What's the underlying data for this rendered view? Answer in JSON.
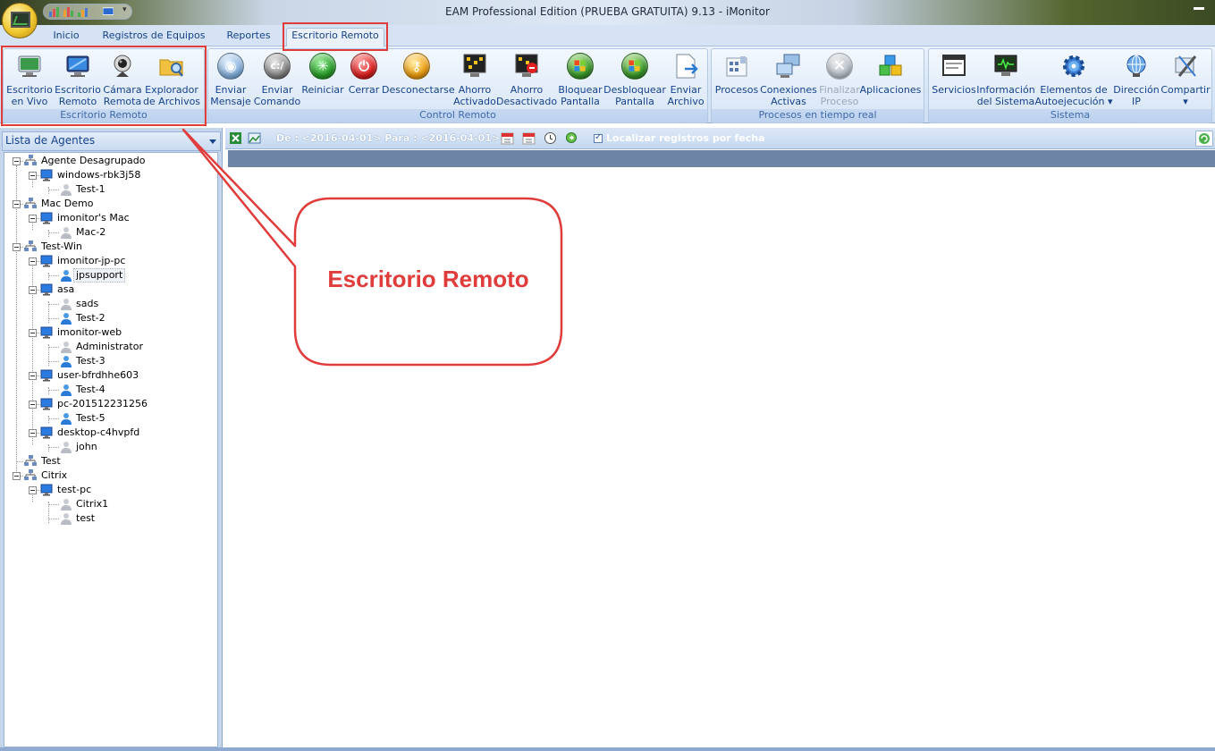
{
  "window": {
    "title": "EAM Professional Edition (PRUEBA GRATUITA) 9.13 - iMonitor"
  },
  "tabs": [
    {
      "label": "Inicio",
      "active": false
    },
    {
      "label": "Registros de Equipos",
      "active": false
    },
    {
      "label": "Reportes",
      "active": false
    },
    {
      "label": "Escritorio Remoto",
      "active": true
    }
  ],
  "ribbon": {
    "groups": [
      {
        "label": "Escritorio Remoto",
        "buttons": [
          {
            "label": "Escritorio\nen Vivo",
            "icon": "monitor-live-icon"
          },
          {
            "label": "Escritorio\nRemoto",
            "icon": "remote-desktop-icon"
          },
          {
            "label": "Cámara\nRemota",
            "icon": "webcam-icon"
          },
          {
            "label": "Explorador\nde Archivos",
            "icon": "folder-search-icon"
          }
        ]
      },
      {
        "label": "Control Remoto",
        "buttons": [
          {
            "label": "Enviar\nMensaje",
            "icon": "message-icon"
          },
          {
            "label": "Enviar\nComando",
            "icon": "command-icon"
          },
          {
            "label": "Reiniciar",
            "icon": "restart-icon"
          },
          {
            "label": "Cerrar",
            "icon": "power-icon"
          },
          {
            "label": "Desconectarse",
            "icon": "logoff-key-icon"
          },
          {
            "label": "Ahorro\nActivado",
            "icon": "power-save-on-icon"
          },
          {
            "label": "Ahorro\nDesactivado",
            "icon": "power-save-off-icon"
          },
          {
            "label": "Bloquear\nPantalla",
            "icon": "lock-screen-icon"
          },
          {
            "label": "Desbloquear\nPantalla",
            "icon": "unlock-screen-icon"
          },
          {
            "label": "Enviar\nArchivo",
            "icon": "send-file-icon"
          }
        ]
      },
      {
        "label": "Procesos en tiempo real",
        "buttons": [
          {
            "label": "Procesos",
            "icon": "processes-icon"
          },
          {
            "label": "Conexiones\nActivas",
            "icon": "network-connections-icon"
          },
          {
            "label": "Finalizar\nProceso",
            "icon": "end-process-icon",
            "disabled": true
          },
          {
            "label": "Aplicaciones",
            "icon": "applications-icon"
          }
        ]
      },
      {
        "label": "Sistema",
        "buttons": [
          {
            "label": "Servicios",
            "icon": "services-icon"
          },
          {
            "label": "Información\ndel Sistema",
            "icon": "system-info-icon"
          },
          {
            "label": "Elementos de\nAutoejecución ▾",
            "icon": "startup-gear-icon"
          },
          {
            "label": "Dirección\nIP",
            "icon": "ip-address-icon"
          },
          {
            "label": "Compartir\n▾",
            "icon": "share-icon"
          }
        ]
      }
    ]
  },
  "agents_panel": {
    "title": "Lista de Agentes",
    "tree": [
      {
        "label": "Agente Desagrupado",
        "type": "group"
      },
      {
        "label": "windows-rbk3j58",
        "type": "computer"
      },
      {
        "label": "Test-1",
        "type": "user-offline"
      },
      {
        "label": "Mac Demo",
        "type": "group"
      },
      {
        "label": "imonitor's Mac",
        "type": "computer"
      },
      {
        "label": "Mac-2",
        "type": "user-offline"
      },
      {
        "label": "Test-Win",
        "type": "group"
      },
      {
        "label": "imonitor-jp-pc",
        "type": "computer"
      },
      {
        "label": "jpsupport",
        "type": "user-online",
        "selected": true
      },
      {
        "label": "asa",
        "type": "computer"
      },
      {
        "label": "sads",
        "type": "user-offline"
      },
      {
        "label": "Test-2",
        "type": "user-online"
      },
      {
        "label": "imonitor-web",
        "type": "computer"
      },
      {
        "label": "Administrator",
        "type": "user-offline"
      },
      {
        "label": "Test-3",
        "type": "user-online"
      },
      {
        "label": "user-bfrdhhe603",
        "type": "computer"
      },
      {
        "label": "Test-4",
        "type": "user-online"
      },
      {
        "label": "pc-201512231256",
        "type": "computer"
      },
      {
        "label": "Test-5",
        "type": "user-online"
      },
      {
        "label": "desktop-c4hvpfd",
        "type": "computer"
      },
      {
        "label": "john",
        "type": "user-offline"
      },
      {
        "label": "Test",
        "type": "group"
      },
      {
        "label": "Citrix",
        "type": "group"
      },
      {
        "label": "test-pc",
        "type": "computer"
      },
      {
        "label": "Citrix1",
        "type": "user-offline"
      },
      {
        "label": "test",
        "type": "user-offline"
      }
    ]
  },
  "records_toolbar": {
    "date_range": "De : <2016-04-01> Para : <2016-04-01>",
    "filter_label": "Localizar registros por fecha",
    "filter_checked": true
  },
  "annotation": {
    "callout_text": "Escritorio Remoto",
    "color": "#e03c3c"
  }
}
